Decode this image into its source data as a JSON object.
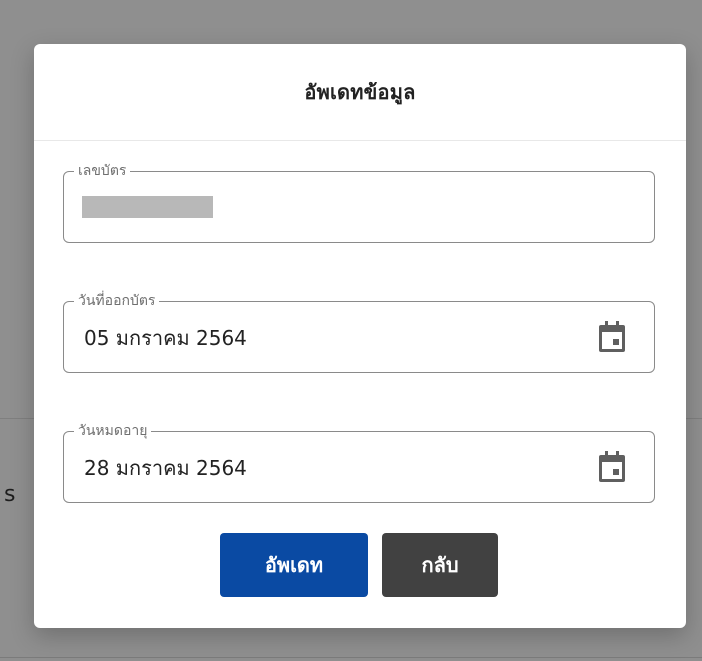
{
  "background": {
    "edge_text": "s"
  },
  "dialog": {
    "title": "อัพเดทข้อมูล",
    "fields": {
      "card_number": {
        "label": "เลขบัตร"
      },
      "issue_date": {
        "label": "วันที่ออกบัตร",
        "value": "05 มกราคม 2564",
        "icon": "calendar-icon"
      },
      "expiry_date": {
        "label": "วันหมดอายุ",
        "value": "28 มกราคม 2564",
        "icon": "calendar-icon"
      }
    },
    "actions": {
      "update_label": "อัพเดท",
      "back_label": "กลับ"
    }
  },
  "colors": {
    "overlay": "#8f8f8f",
    "dialog_background": "#ffffff",
    "primary_button": "#0a4aa3",
    "secondary_button": "#414141",
    "field_border": "#8a8a8a",
    "icon": "#5f5f5f"
  }
}
